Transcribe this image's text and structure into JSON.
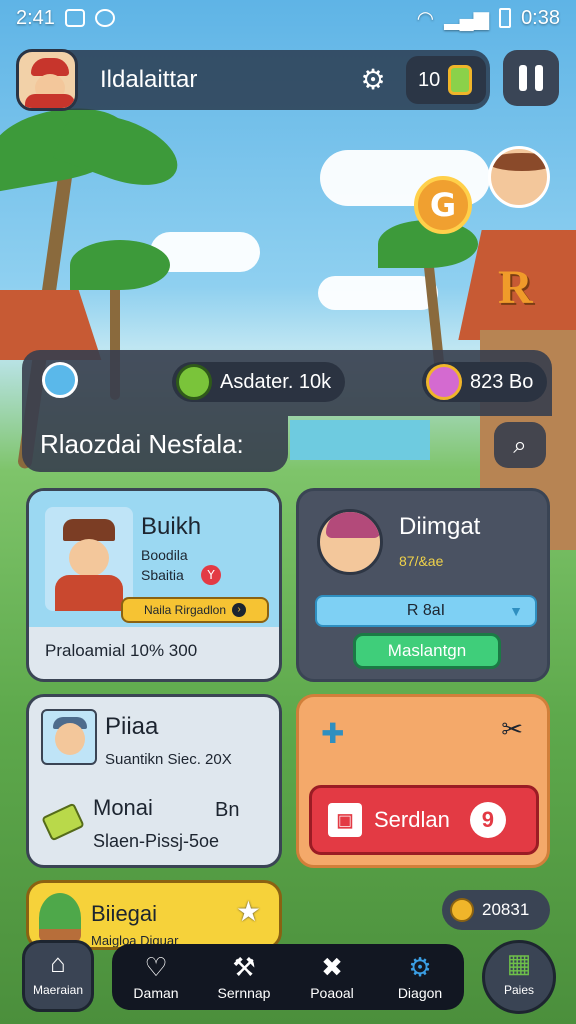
{
  "statusbar": {
    "time_left": "2:41",
    "time_right": "0:38"
  },
  "header": {
    "player_name": "Ildalaittar",
    "coins": "10"
  },
  "resources": {
    "item_b": "Asdater. 10k",
    "item_c": "823 Bo"
  },
  "subbar_title": "Rlaozdai Nesfala:",
  "cards": {
    "card1": {
      "title": "Buikh",
      "line1": "Boodila",
      "line2": "Sbaitia",
      "button": "Naila Rirgadlon",
      "footer": "Praloamial 10% 300"
    },
    "card2": {
      "title": "Diimgat",
      "sub": "87/&ae",
      "select_value": "R 8aI",
      "button": "Maslantgn"
    },
    "card3": {
      "title": "Piiaa",
      "line1": "Suantikn Siec. 20X",
      "line2": "Monai",
      "line2_right": "Bn",
      "line3": "Slaen-Pissj-5oe"
    },
    "card4": {
      "button": "Serdlan",
      "badge": "9"
    },
    "card5": {
      "title": "Biiegai",
      "sub": "Maigloa Diguar"
    }
  },
  "gold": "20831",
  "nav": {
    "home": "Maeraian",
    "items": [
      {
        "label": "Daman",
        "icon": "heart-icon"
      },
      {
        "label": "Sernnap",
        "icon": "wrench-icon"
      },
      {
        "label": "Poaoal",
        "icon": "pickaxe-icon"
      },
      {
        "label": "Diagon",
        "icon": "gear-icon"
      }
    ],
    "right": "Paies"
  },
  "colors": {
    "accent_blue": "#3a9ee4",
    "card_red": "#e33a44",
    "green_btn": "#3fce7a",
    "gold_yellow": "#f6c333"
  }
}
